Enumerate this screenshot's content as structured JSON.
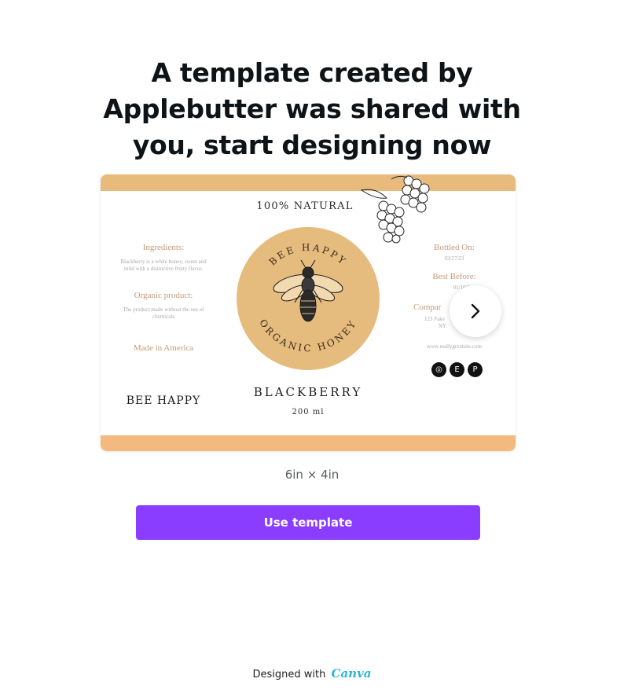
{
  "headline": {
    "line1": "A template created by",
    "line2": "Applebutter was shared with",
    "line3": "you, start designing now"
  },
  "preview": {
    "top_label": "100% NATURAL",
    "left": {
      "ingredients_title": "Ingredients:",
      "ingredients_text_1": "Blackberry is a white honey, sweet and",
      "ingredients_text_2": "mild with a distinctive fruity flavor.",
      "organic_title": "Organic product:",
      "organic_text_1": "The product made without the use of",
      "organic_text_2": "chemicals",
      "origin": "Made in America",
      "brand": "BEE HAPPY"
    },
    "badge": {
      "top_arc": "BEE HAPPY",
      "bottom_arc": "ORGANIC HONEY"
    },
    "product_name": "BLACKBERRY",
    "volume": "200 ml",
    "right": {
      "bottled_title": "Bottled On:",
      "bottled_date": "03/27/23",
      "best_before_title": "Best Before:",
      "best_before_date": "01/10/2",
      "company_title": "Compar",
      "company_address": "123 Fake",
      "company_city": "NY",
      "website": "www.reallygreatsite.com"
    },
    "social_icons": [
      "instagram-icon",
      "etsy-icon",
      "pinterest-icon"
    ],
    "social_glyphs": [
      "◎",
      "E",
      "P"
    ],
    "colors": {
      "band_top": "#e8bb7d",
      "band_bottom": "#f4b97f",
      "badge": "#e6bb7e"
    }
  },
  "next_button": {
    "icon": "chevron-right-icon"
  },
  "dimensions": "6in × 4in",
  "use_template_label": "Use template",
  "footer": {
    "prefix": "Designed with",
    "brand": "Canva"
  },
  "colors": {
    "accent": "#8b3dff",
    "canva_brand": "#2cb7d6"
  }
}
